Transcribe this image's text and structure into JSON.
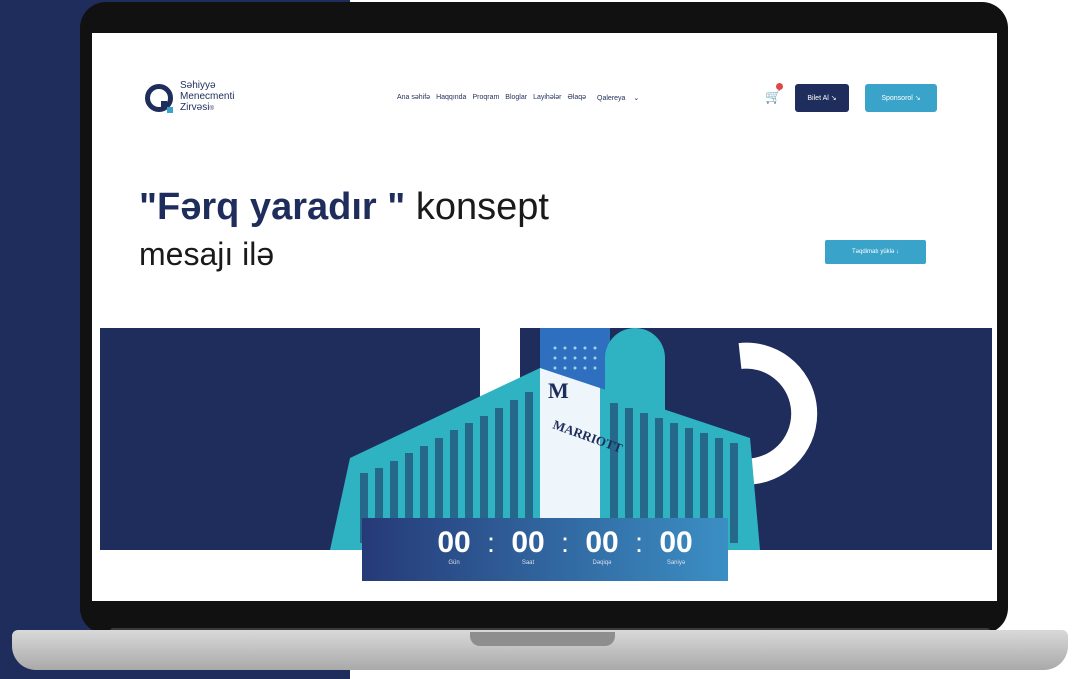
{
  "site": {
    "logo_line1": "Səhiyyə",
    "logo_line2": "Menecmenti",
    "logo_line3": "Zirvəsi",
    "logo_suffix": "®"
  },
  "nav": {
    "items": [
      "Ana səhifə",
      "Haqqında",
      "Proqram",
      "Bloglar",
      "Layihələr",
      "Əlaqə"
    ],
    "gallery_label": "Qalereya",
    "gallery_chevron": "⌄"
  },
  "cart": {
    "icon": "cart-icon",
    "glyph": "🛒"
  },
  "buttons": {
    "bilet_label": "Bilet Al ↘",
    "sponsor_label": "Sponsorol ↘",
    "teqdimat_label": "Təqdimatı yüklə ↓"
  },
  "hero": {
    "quote_open": "\"",
    "bold_text": "Fərq yaradır",
    "quote_close": " \"",
    "rest_text": " konsept",
    "line2": "mesajı ilə"
  },
  "countdown": {
    "units": [
      {
        "value": "00",
        "label": "Gün"
      },
      {
        "value": "00",
        "label": "Saat"
      },
      {
        "value": "00",
        "label": "Dəqiqə"
      },
      {
        "value": "00",
        "label": "Saniyə"
      }
    ],
    "separator": ":"
  },
  "banner": {
    "building_sign": "MARRIOTT"
  },
  "colors": {
    "navy": "#1f2d5c",
    "accent": "#3aa3c9",
    "teal": "#2fb2c2"
  }
}
